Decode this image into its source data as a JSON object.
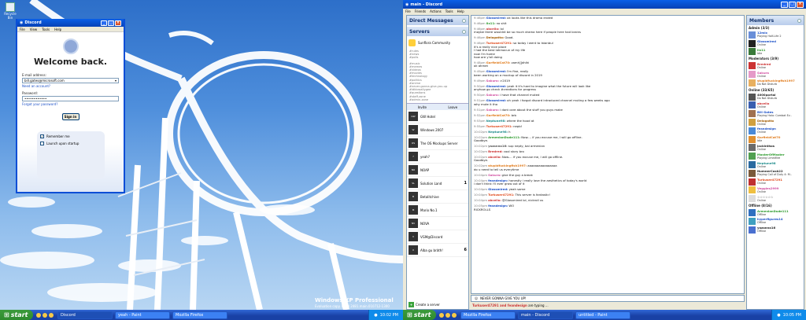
{
  "left": {
    "desktop_icon": "Recycle Bin",
    "watermark": "Windows XP Professional",
    "watermark_sub": "Evaluation copy. Build 2481.main.010712-1300",
    "login": {
      "title": "Discord",
      "menu": [
        "File",
        "View",
        "Tools",
        "Help"
      ],
      "heading": "Welcome back.",
      "email_label": "E-mail address:",
      "email_value": "bill.gates@microsoft.com",
      "need_account": "Need an account?",
      "password_label": "Password:",
      "password_value": "••••••••••••",
      "forgot": "Forgot your password?",
      "signin": "Sign in",
      "remember": "Remember me",
      "launch": "Launch upon startup"
    },
    "taskbar": {
      "start": "start",
      "tasks": [
        "Discord",
        "yeah - Paint",
        "Mozilla Firefox"
      ],
      "clock": "10:02 PM"
    }
  },
  "right": {
    "title": "main - Discord",
    "menu": [
      "File",
      "Friends",
      "Actions",
      "Tools",
      "Help"
    ],
    "dm_header": "Direct Messages",
    "servers_header": "Servers",
    "top_server": "Sunflora Community",
    "channels": [
      "#rules",
      "#news",
      "#polls",
      "",
      "#music",
      "#memes",
      "#videos",
      "#movies",
      "#technology",
      "#politics",
      "#anime",
      "#never-gonna-give-you-up",
      "#idkbroallygee",
      "#questions",
      "#staff-zone",
      "#admin-zone"
    ],
    "invite": "Invite",
    "leave": "Leave",
    "servers": [
      {
        "name": "GW Hotel",
        "ic": "GW",
        "count": ""
      },
      {
        "name": "Windows 2007",
        "ic": "W",
        "count": ""
      },
      {
        "name": "The OS Mockups Server",
        "ic": "OS",
        "count": ""
      },
      {
        "name": "yeah?",
        "ic": "?",
        "count": ""
      },
      {
        "name": "NOAP",
        "ic": "NO",
        "count": ""
      },
      {
        "name": "Solution Land",
        "ic": "SL",
        "count": "1"
      },
      {
        "name": "Betalitchive",
        "ic": "B",
        "count": ""
      },
      {
        "name": "Mario No.1",
        "ic": "M",
        "count": ""
      },
      {
        "name": "NOVA",
        "ic": "NV",
        "count": ""
      },
      {
        "name": "VGM@Discord",
        "ic": "V",
        "count": ""
      },
      {
        "name": "Alba gu bràth!",
        "ic": "X",
        "count": "6"
      }
    ],
    "create_server": "Create a server",
    "messages": [
      {
        "t": "9:46pm",
        "u": "Glossmired:",
        "c": "#1a4fc7",
        "m": "ok looks like this drama ended"
      },
      {
        "t": "9:46pm",
        "u": "Ilx11:",
        "c": "#2c9a2c",
        "m": "no shit"
      },
      {
        "t": "9:46pm",
        "u": "abcello:",
        "c": "#c33",
        "m": "lol\nmaybe there wouldnt be so much drama here if people here had brains"
      },
      {
        "t": "9:46pm",
        "u": "Delogatto:",
        "c": "#a05a00",
        "m": "Good."
      },
      {
        "t": "9:46pm",
        "u": "Turkuser47291:",
        "c": "#e0481a",
        "m": "so today I went to Istanbul\nit's a really nice place\nI had the best lahmacun of my life\nnow i'm home\nhow are y'all doing"
      },
      {
        "t": "9:48pm",
        "u": "GarfieldCat70:",
        "c": "#e07a1a",
        "m": "zamh]]dhlhi\nok ahmet"
      },
      {
        "t": "9:49pm",
        "u": "Glossmired:",
        "c": "#1a4fc7",
        "m": "I'm fine, really\nbeen working on a mockup of discord in 2019"
      },
      {
        "t": "9:49pm",
        "u": "Sakura:",
        "c": "#d04ea0",
        "m": ">2019"
      },
      {
        "t": "9:50pm",
        "u": "Glossmired:",
        "c": "#1a4fc7",
        "m": "yeah it it's hard to imagine what the future will look like\nanyhow go check #creations for progress"
      },
      {
        "t": "9:50pm",
        "u": "Sakura:",
        "c": "#d04ea0",
        "m": "i have that channel muted"
      },
      {
        "t": "9:51pm",
        "u": "Glossmired:",
        "c": "#1a4fc7",
        "m": "oh yeah i forgot discord introduced channel muting a few weeks ago\nwhy mute it tho"
      },
      {
        "t": "9:51pm",
        "u": "Sakura:",
        "c": "#d04ea0",
        "m": "i dont care about the stuff you guys make"
      },
      {
        "t": "9:52pm",
        "u": "GarfieldCat70:",
        "c": "#e07a1a",
        "m": "brb"
      },
      {
        "t": "9:53pm",
        "u": "Neptune98:",
        "c": "#1a8a8a",
        "m": "where the hood at"
      },
      {
        "t": "9:55pm",
        "u": "Turkuser47291:",
        "c": "#e0481a",
        "m": "nepb!"
      },
      {
        "t": "10:02pm",
        "u": "Neptune98:",
        "c": "#1a8a8a",
        "m": "h"
      },
      {
        "t": "10:02pm",
        "u": "ArmenianDude111:",
        "c": "#2c9a2c",
        "m": "Now.... if you excuse me, I will go offline.\nGoodbye."
      },
      {
        "t": "10:02pm",
        "u": "yazanno16:",
        "c": "#555",
        "m": "sup nepty, bai armenian"
      },
      {
        "t": "10:02pm",
        "u": "Bredred:",
        "c": "#c33",
        "m": "cool story bro"
      },
      {
        "t": "10:02pm",
        "u": "abcello:",
        "c": "#c33",
        "m": "Now.... if you excuse me, I will go offline.\nGoodbye."
      },
      {
        "t": "10:02pm",
        "u": "stupidfuckingfish1997:",
        "c": "#e07a1a",
        "m": "aaaaaaaaaaaaaaaa\ndo u need to tell us everytime"
      },
      {
        "t": "10:04pm",
        "u": "Sakura:",
        "c": "#d04ea0",
        "m": "give the guy a break"
      },
      {
        "t": "10:04pm",
        "u": "feandesign:",
        "c": "#1a4fc7",
        "m": "honestly i really love the aesthetics of today's world\ni don't think i'll ever grow out of it"
      },
      {
        "t": "10:04pm",
        "u": "Glossmired:",
        "c": "#1a4fc7",
        "m": "yeah same"
      },
      {
        "t": "10:04pm",
        "u": "Turkuser47291:",
        "c": "#e0481a",
        "m": "This server is fantastic!"
      },
      {
        "t": "10:04pm",
        "u": "abcello:",
        "c": "#c33",
        "m": "@Glossmired lol, nickroll us"
      },
      {
        "t": "10:05pm",
        "u": "feandesign:",
        "c": "#1a4fc7",
        "m": "WO\nRICKROLLS"
      }
    ],
    "input_text": "NEVER GONNA GIVE YOU UP!",
    "typing_users": "Turkuser47291 and feandesign",
    "typing_suffix": "are typing ...",
    "members_header": "Members",
    "groups": [
      {
        "label": "Admin (3/3)",
        "members": [
          {
            "n": "12mix",
            "s": "Playing Half-Life 2",
            "c": "#1a4fc7",
            "av": "#6a8fd8"
          },
          {
            "n": "Glossmired",
            "s": "Online",
            "c": "#1a4fc7",
            "av": "#222"
          },
          {
            "n": "Ilx11",
            "s": "Idle",
            "c": "#2c9a2c",
            "av": "#3a7a3a"
          }
        ]
      },
      {
        "label": "Moderators (3/9)",
        "members": [
          {
            "n": "Bredred",
            "s": "Online",
            "c": "#c33",
            "av": "#c33"
          },
          {
            "n": "Sakura",
            "s": "Online",
            "c": "#d04ea0",
            "av": "#e59ac8"
          },
          {
            "n": "stupidfuckingfish1997",
            "s": "Do Not Disturb",
            "c": "#e07a1a",
            "av": "#e8b060"
          }
        ]
      },
      {
        "label": "Online (33/65)",
        "members": [
          {
            "n": "4000portal",
            "s": "Do Not Disturb",
            "c": "#222",
            "av": "#555"
          },
          {
            "n": "abcello",
            "s": "Online",
            "c": "#c33",
            "av": "#3a5fb0"
          },
          {
            "n": "Bill Gates",
            "s": "Playing Halo: Combat Ev..",
            "c": "#1a4fc7",
            "av": "#a07050"
          },
          {
            "n": "Delogatto",
            "s": "Online",
            "c": "#a05a00",
            "av": "#d0a040"
          },
          {
            "n": "feandesign",
            "s": "Online",
            "c": "#1a4fc7",
            "av": "#4a8ad8"
          },
          {
            "n": "GarfieldCat70",
            "s": "Idle",
            "c": "#e07a1a",
            "av": "#e09030"
          },
          {
            "n": "jackinthos",
            "s": "Online",
            "c": "#222",
            "av": "#6a6a6a"
          },
          {
            "n": "MasterOfMaster",
            "s": "Playing LimeWire",
            "c": "#2c9a2c",
            "av": "#50a050"
          },
          {
            "n": "Neptune98",
            "s": "Online",
            "c": "#1a8a8a",
            "av": "#2a6aa0"
          },
          {
            "n": "NumnerCash22",
            "s": "Playing Call of Duty 4: M..",
            "c": "#222",
            "av": "#7a5a3a"
          },
          {
            "n": "Turkuser47291",
            "s": "Online",
            "c": "#e0481a",
            "av": "#c03030"
          },
          {
            "n": "Veggies2999",
            "s": "Online",
            "c": "#d04ea0",
            "av": "#f0c040"
          },
          {
            "n": "☆☆☆☆☆☆",
            "s": "Online",
            "c": "#222",
            "av": "#ddd"
          }
        ]
      },
      {
        "label": "Offline (8/16)",
        "members": [
          {
            "n": "ArmenianDude111",
            "s": "Offline",
            "c": "#2c9a2c",
            "av": "#3070c0"
          },
          {
            "n": "hyperfigures14",
            "s": "Offline",
            "c": "#1a4fc7",
            "av": "#40a0c0"
          },
          {
            "n": "yazanno16",
            "s": "Offline",
            "c": "#222",
            "av": "#4a70d0"
          }
        ]
      }
    ],
    "taskbar": {
      "start": "start",
      "tasks": [
        "Mozilla Firefox",
        "main - Discord",
        "untitled - Paint"
      ],
      "clock": "10:05 PM"
    }
  },
  "colors": {
    "xp_blue": "#0a5fe8",
    "taskbar": "#245edb",
    "start_green": "#3c9b3c"
  }
}
